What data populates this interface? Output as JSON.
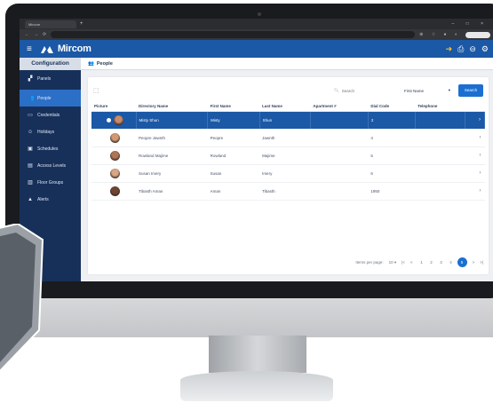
{
  "browser": {
    "tab_title": "Mircom",
    "url": "",
    "window_controls": "– □ ×"
  },
  "header": {
    "menu_icon": "≡",
    "brand": "Mircom",
    "icons": [
      "login-icon",
      "print-icon",
      "help-icon",
      "settings-icon"
    ]
  },
  "sidebar": {
    "title": "Configuration",
    "items": [
      {
        "label": "Panels",
        "icon": "panels-icon",
        "glyph": "▞"
      },
      {
        "label": "People",
        "icon": "people-icon",
        "glyph": "👥"
      },
      {
        "label": "Credentials",
        "icon": "credentials-icon",
        "glyph": "▭"
      },
      {
        "label": "Holidays",
        "icon": "holidays-icon",
        "glyph": "☺"
      },
      {
        "label": "Schedules",
        "icon": "schedules-icon",
        "glyph": "▣"
      },
      {
        "label": "Access Levels",
        "icon": "access-levels-icon",
        "glyph": "▤"
      },
      {
        "label": "Floor Groups",
        "icon": "floor-groups-icon",
        "glyph": "▥"
      },
      {
        "label": "Alerts",
        "icon": "alerts-icon",
        "glyph": "▲"
      }
    ],
    "active_index": 1
  },
  "page": {
    "title": "People"
  },
  "toolbar": {
    "search_placeholder": "Search",
    "field_value": "First Name",
    "search_button": "Search"
  },
  "table": {
    "columns": [
      "Picture",
      "Directory Name",
      "First Name",
      "Last Name",
      "Apartment #",
      "Dial Code",
      "Telephone"
    ],
    "rows": [
      {
        "directory_name": "Misty Shun",
        "first_name": "Misty",
        "last_name": "Shun",
        "apartment": "",
        "dial_code": "2",
        "telephone": "",
        "selected": true
      },
      {
        "directory_name": "Peopre Jawnth",
        "first_name": "Peopre",
        "last_name": "Jawnth",
        "apartment": "",
        "dial_code": "4",
        "telephone": "",
        "selected": false
      },
      {
        "directory_name": "Rowland Majime",
        "first_name": "Rowland",
        "last_name": "Majime",
        "apartment": "",
        "dial_code": "6",
        "telephone": "",
        "selected": false
      },
      {
        "directory_name": "Susan Imery",
        "first_name": "Susan",
        "last_name": "Imery",
        "apartment": "",
        "dial_code": "6",
        "telephone": "",
        "selected": false
      },
      {
        "directory_name": "Tibasth Aman",
        "first_name": "Aman",
        "last_name": "Tibasth",
        "apartment": "",
        "dial_code": "1950",
        "telephone": "",
        "selected": false
      }
    ]
  },
  "pagination": {
    "items_label": "Items per page:",
    "items_value": "10",
    "pages": [
      "1",
      "2",
      "3",
      "4",
      "5"
    ],
    "current_page": "5"
  },
  "colors": {
    "brand_blue": "#1b58a6",
    "sidebar_navy": "#17305a",
    "accent_blue": "#1b6fd1",
    "login_yellow": "#f6c12d"
  }
}
